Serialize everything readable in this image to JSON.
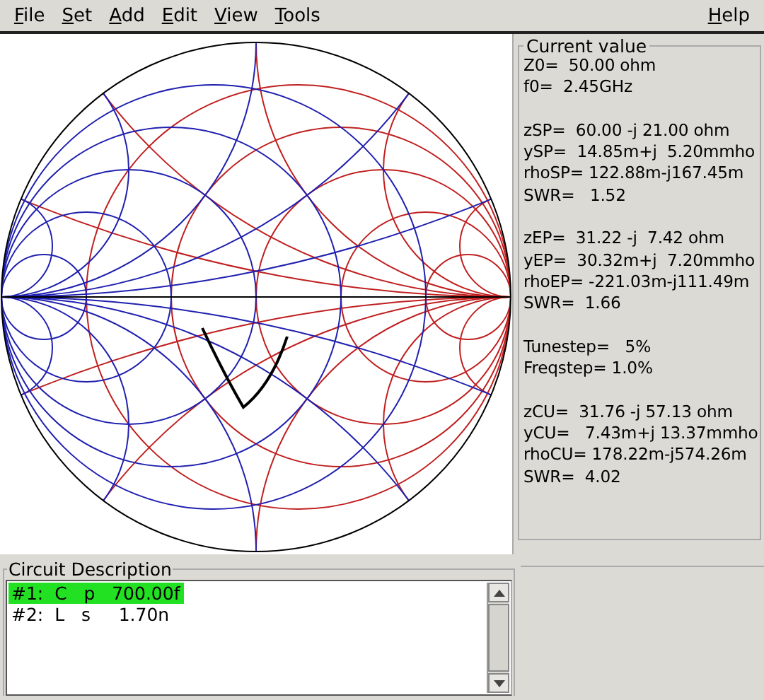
{
  "menu": [
    {
      "label": "File"
    },
    {
      "label": "Set"
    },
    {
      "label": "Add"
    },
    {
      "label": "Edit"
    },
    {
      "label": "View"
    },
    {
      "label": "Tools"
    },
    {
      "label": "Help"
    }
  ],
  "current_value": {
    "title": "Current value",
    "groups": [
      [
        "Z0=  50.00 ohm",
        "f0=  2.45GHz"
      ],
      [
        "zSP=  60.00 -j 21.00 ohm",
        "ySP=  14.85m+j  5.20mmho",
        "rhoSP= 122.88m-j167.45m",
        "SWR=   1.52"
      ],
      [
        "zEP=  31.22 -j  7.42 ohm",
        "yEP=  30.32m+j  7.20mmho",
        "rhoEP= -221.03m-j111.49m",
        "SWR=  1.66"
      ],
      [
        "Tunestep=   5%",
        "Freqstep= 1.0%"
      ],
      [
        "zCU=  31.76 -j 57.13 ohm",
        "yCU=   7.43m+j 13.37mmho",
        "rhoCU= 178.22m-j574.26m",
        "SWR=  4.02"
      ]
    ]
  },
  "circuit_description": {
    "title": "Circuit Description",
    "rows": [
      {
        "text": "#1:  C   p   700.00f",
        "selected": true
      },
      {
        "text": "#2:  L   s     1.70n",
        "selected": false
      }
    ]
  }
}
